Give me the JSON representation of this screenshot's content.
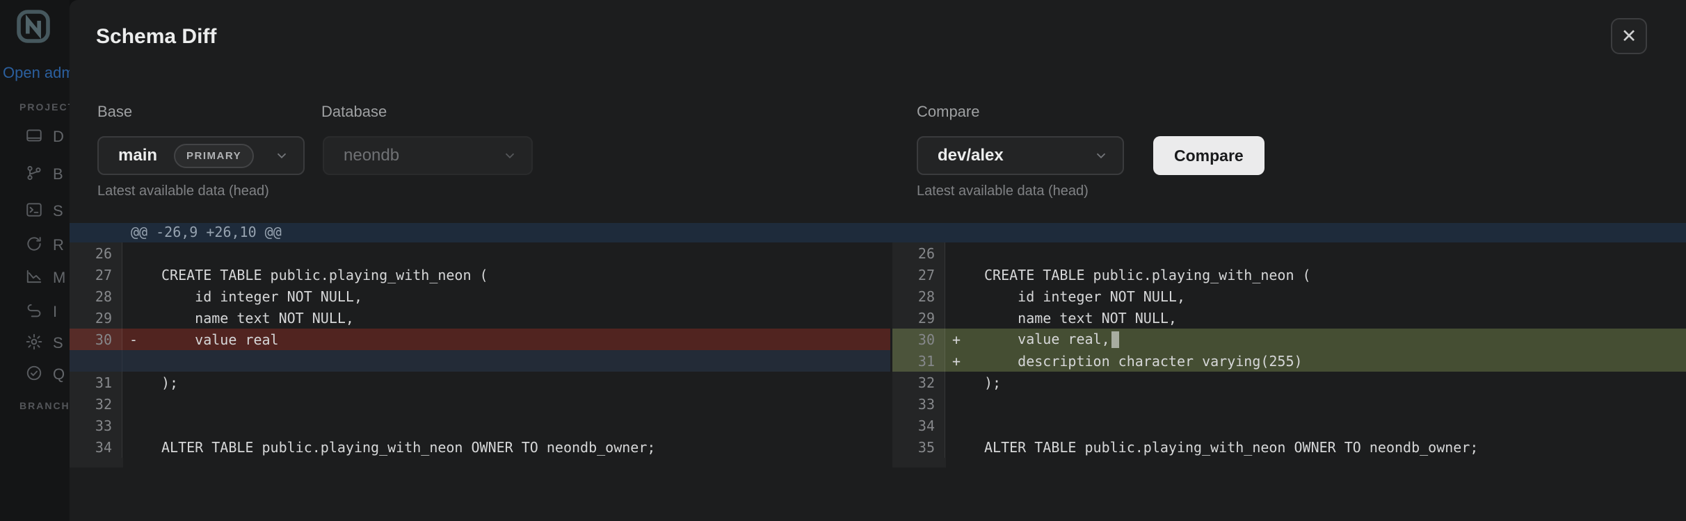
{
  "sidebar": {
    "open_link": "Open adm",
    "section_project": "PROJECT",
    "section_branch": "BRANCH",
    "items": [
      {
        "icon": "dashboard-icon",
        "label": "D"
      },
      {
        "icon": "branches-icon",
        "label": "B"
      },
      {
        "icon": "sql-editor-icon",
        "label": "S"
      },
      {
        "icon": "restore-icon",
        "label": "R"
      },
      {
        "icon": "monitoring-icon",
        "label": "M"
      },
      {
        "icon": "integrations-icon",
        "label": "I"
      },
      {
        "icon": "settings-icon",
        "label": "S"
      },
      {
        "icon": "quickstart-icon",
        "label": "Q"
      }
    ]
  },
  "modal": {
    "title": "Schema Diff",
    "close_glyph": "✕",
    "form": {
      "base_label": "Base",
      "base_value": "main",
      "base_badge": "PRIMARY",
      "base_helper": "Latest available data (head)",
      "database_label": "Database",
      "database_value": "neondb",
      "compare_label": "Compare",
      "compare_value": "dev/alex",
      "compare_helper": "Latest available data (head)",
      "compare_button": "Compare"
    },
    "diff": {
      "hunk_header": "@@ -26,9 +26,10 @@",
      "left_rows": [
        {
          "num": "26",
          "marker": "",
          "code": "",
          "type": "context"
        },
        {
          "num": "27",
          "marker": "",
          "code": "CREATE TABLE public.playing_with_neon (",
          "type": "context"
        },
        {
          "num": "28",
          "marker": "",
          "code": "    id integer NOT NULL,",
          "type": "context"
        },
        {
          "num": "29",
          "marker": "",
          "code": "    name text NOT NULL,",
          "type": "context"
        },
        {
          "num": "30",
          "marker": "-",
          "code": "    value real",
          "type": "removed"
        },
        {
          "num": "",
          "marker": "",
          "code": "",
          "type": "phantom"
        },
        {
          "num": "31",
          "marker": "",
          "code": ");",
          "type": "context"
        },
        {
          "num": "32",
          "marker": "",
          "code": "",
          "type": "context"
        },
        {
          "num": "33",
          "marker": "",
          "code": "",
          "type": "context"
        },
        {
          "num": "34",
          "marker": "",
          "code": "ALTER TABLE public.playing_with_neon OWNER TO neondb_owner;",
          "type": "context"
        }
      ],
      "right_rows": [
        {
          "num": "26",
          "marker": "",
          "code": "",
          "type": "context"
        },
        {
          "num": "27",
          "marker": "",
          "code": "CREATE TABLE public.playing_with_neon (",
          "type": "context"
        },
        {
          "num": "28",
          "marker": "",
          "code": "    id integer NOT NULL,",
          "type": "context"
        },
        {
          "num": "29",
          "marker": "",
          "code": "    name text NOT NULL,",
          "type": "context"
        },
        {
          "num": "30",
          "marker": "+",
          "code": "    value real,",
          "type": "added",
          "cursor": true
        },
        {
          "num": "31",
          "marker": "+",
          "code": "    description character varying(255)",
          "type": "added"
        },
        {
          "num": "32",
          "marker": "",
          "code": ");",
          "type": "context"
        },
        {
          "num": "33",
          "marker": "",
          "code": "",
          "type": "context"
        },
        {
          "num": "34",
          "marker": "",
          "code": "",
          "type": "context"
        },
        {
          "num": "35",
          "marker": "",
          "code": "ALTER TABLE public.playing_with_neon OWNER TO neondb_owner;",
          "type": "context"
        }
      ]
    }
  },
  "colors": {
    "modal_bg": "#1c1d1e",
    "removed_bg": "#512420",
    "added_bg": "#454e33",
    "phantom_bg": "#232b37",
    "hunk_bg": "#1e2b3b",
    "accent_link": "#2b5f9e",
    "button_bg": "#ebebec"
  }
}
